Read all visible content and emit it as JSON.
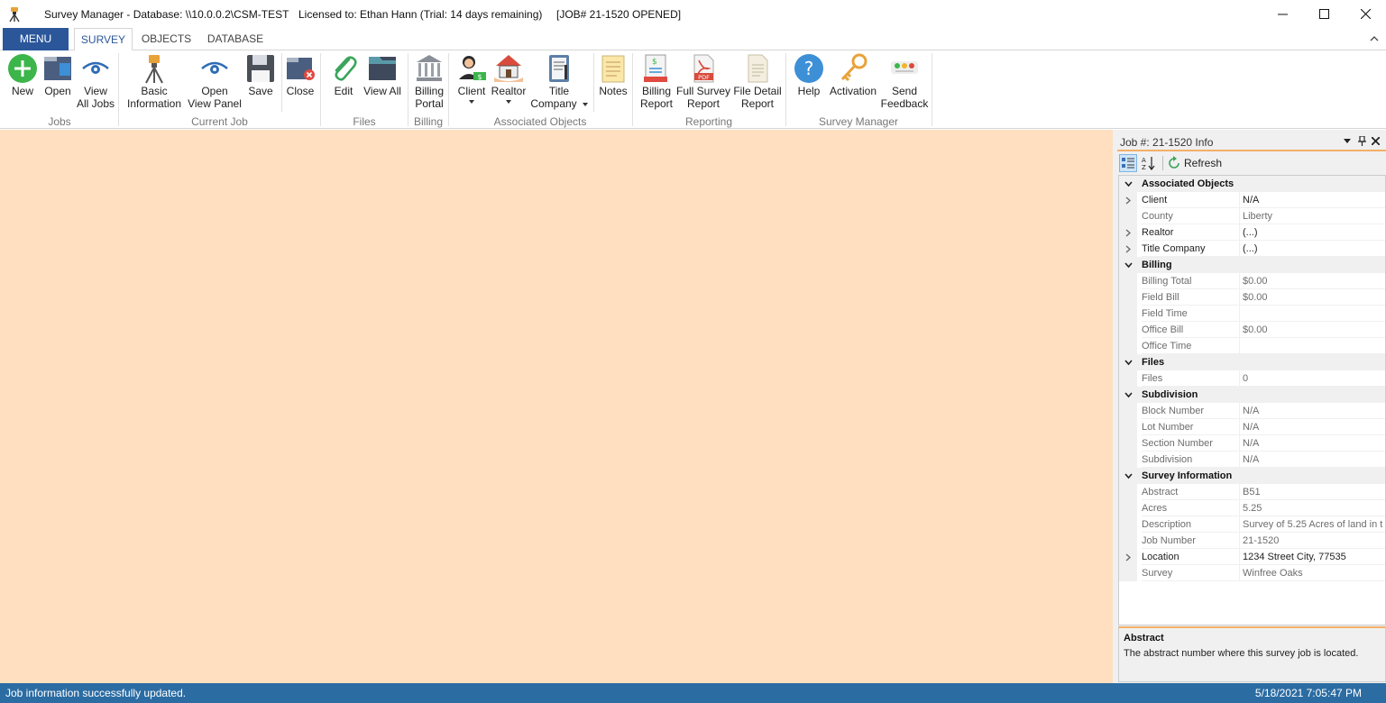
{
  "titlebar": {
    "app_name": "Survey Manager - Database: \\\\10.0.0.2\\CSM-TEST",
    "license": "Licensed to: Ethan Hann (Trial: 14 days remaining)",
    "job_status": "[JOB# 21-1520 OPENED]"
  },
  "tabs": [
    "MENU",
    "SURVEY",
    "OBJECTS",
    "DATABASE"
  ],
  "ribbon": {
    "jobs": {
      "label": "Jobs",
      "new": "New",
      "open": "Open",
      "view_all_1": "View",
      "view_all_2": "All Jobs"
    },
    "current_job": {
      "label": "Current Job",
      "basic_1": "Basic",
      "basic_2": "Information",
      "open_view_1": "Open",
      "open_view_2": "View Panel",
      "save": "Save",
      "close": "Close"
    },
    "files": {
      "label": "Files",
      "edit": "Edit",
      "view_all": "View All"
    },
    "billing": {
      "label": "Billing",
      "portal_1": "Billing",
      "portal_2": "Portal"
    },
    "associated": {
      "label": "Associated Objects",
      "client": "Client",
      "realtor": "Realtor",
      "title_1": "Title",
      "title_2": "Company",
      "notes": "Notes"
    },
    "reporting": {
      "label": "Reporting",
      "billing_1": "Billing",
      "billing_2": "Report",
      "full_1": "Full Survey",
      "full_2": "Report",
      "detail_1": "File Detail",
      "detail_2": "Report"
    },
    "survey_manager": {
      "label": "Survey Manager",
      "help": "Help",
      "activation": "Activation",
      "feedback_1": "Send",
      "feedback_2": "Feedback"
    }
  },
  "panel": {
    "title": "Job #: 21-1520 Info",
    "refresh": "Refresh",
    "rows": [
      {
        "type": "cat",
        "name": "Associated Objects"
      },
      {
        "type": "prop",
        "name": "Client",
        "value": "N/A",
        "expand": true,
        "dim": false
      },
      {
        "type": "prop",
        "name": "County",
        "value": "Liberty",
        "expand": false,
        "dim": true
      },
      {
        "type": "prop",
        "name": "Realtor",
        "value": "(...)",
        "expand": true,
        "dim": false
      },
      {
        "type": "prop",
        "name": "Title Company",
        "value": "(...)",
        "expand": true,
        "dim": false
      },
      {
        "type": "cat",
        "name": "Billing"
      },
      {
        "type": "prop",
        "name": "Billing Total",
        "value": "$0.00",
        "expand": false,
        "dim": true
      },
      {
        "type": "prop",
        "name": "Field Bill",
        "value": "$0.00",
        "expand": false,
        "dim": true
      },
      {
        "type": "prop",
        "name": "Field Time",
        "value": "",
        "expand": false,
        "dim": true
      },
      {
        "type": "prop",
        "name": "Office Bill",
        "value": "$0.00",
        "expand": false,
        "dim": true
      },
      {
        "type": "prop",
        "name": "Office Time",
        "value": "",
        "expand": false,
        "dim": true
      },
      {
        "type": "cat",
        "name": "Files"
      },
      {
        "type": "prop",
        "name": "Files",
        "value": "0",
        "expand": false,
        "dim": true
      },
      {
        "type": "cat",
        "name": "Subdivision"
      },
      {
        "type": "prop",
        "name": "Block Number",
        "value": "N/A",
        "expand": false,
        "dim": true
      },
      {
        "type": "prop",
        "name": "Lot Number",
        "value": "N/A",
        "expand": false,
        "dim": true
      },
      {
        "type": "prop",
        "name": "Section Number",
        "value": "N/A",
        "expand": false,
        "dim": true
      },
      {
        "type": "prop",
        "name": "Subdivision",
        "value": "N/A",
        "expand": false,
        "dim": true
      },
      {
        "type": "cat",
        "name": "Survey Information"
      },
      {
        "type": "prop",
        "name": "Abstract",
        "value": "B51",
        "expand": false,
        "dim": true
      },
      {
        "type": "prop",
        "name": "Acres",
        "value": "5.25",
        "expand": false,
        "dim": true
      },
      {
        "type": "prop",
        "name": "Description",
        "value": "Survey of 5.25 Acres of land in t",
        "expand": false,
        "dim": true
      },
      {
        "type": "prop",
        "name": "Job Number",
        "value": "21-1520",
        "expand": false,
        "dim": true
      },
      {
        "type": "prop",
        "name": "Location",
        "value": "1234 Street City, 77535",
        "expand": true,
        "dim": false
      },
      {
        "type": "prop",
        "name": "Survey",
        "value": "Winfree Oaks",
        "expand": false,
        "dim": true
      }
    ],
    "description_title": "Abstract",
    "description_text": "The abstract number where this survey job is located."
  },
  "status": {
    "message": "Job information successfully updated.",
    "timestamp": "5/18/2021 7:05:47 PM"
  },
  "colors": {
    "accent": "#2b579a",
    "workspace": "#ffdfc0",
    "statusbar": "#2b6ca3",
    "panel_accent": "#f4b06a"
  }
}
